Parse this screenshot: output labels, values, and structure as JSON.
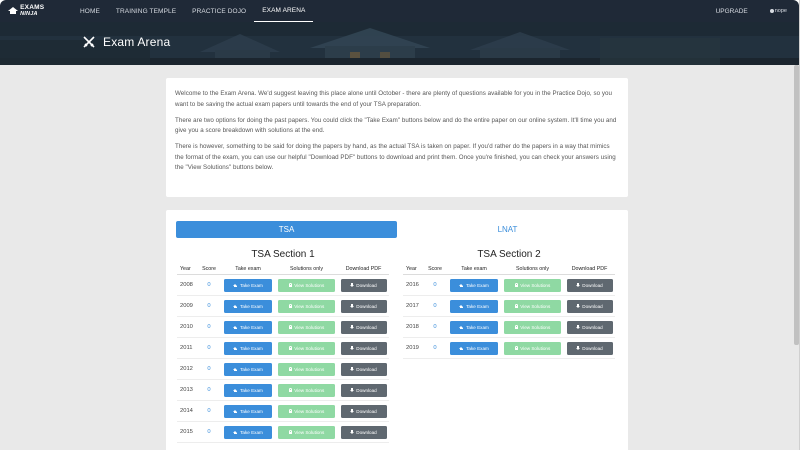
{
  "nav": {
    "logo_main": "EXAMS",
    "logo_accent": "NINJA",
    "links": [
      "HOME",
      "TRAINING TEMPLE",
      "PRACTICE DOJO",
      "EXAM ARENA"
    ],
    "upgrade": "UPGRADE",
    "user": "nope"
  },
  "banner": {
    "title": "Exam Arena"
  },
  "intro": {
    "p1": "Welcome to the Exam Arena. We'd suggest leaving this place alone until October - there are plenty of questions available for you in the Practice Dojo, so you want to be saving the actual exam papers until towards the end of your TSA preparation.",
    "p2": "There are two options for doing the past papers. You could click the \"Take Exam\" buttons below and do the entire paper on our online system. It'll time you and give you a score breakdown with solutions at the end.",
    "p3": "There is however, something to be said for doing the papers by hand, as the actual TSA is taken on paper. If you'd rather do the papers in a way that mimics the format of the exam, you can use our helpful \"Download PDF\" buttons to download and print them. Once you're finished, you can check your answers using the \"View Solutions\" buttons below."
  },
  "tabs": {
    "tsa": "TSA",
    "lnat": "LNAT"
  },
  "table": {
    "headers": {
      "year": "Year",
      "score": "Score",
      "take": "Take exam",
      "solutions": "Solutions only",
      "pdf": "Download PDF"
    },
    "buttons": {
      "take": "Take Exam",
      "solutions": "View Solutions",
      "download": "Download"
    }
  },
  "section1": {
    "title": "TSA Section 1",
    "rows": [
      {
        "year": "2008",
        "score": "0"
      },
      {
        "year": "2009",
        "score": "0"
      },
      {
        "year": "2010",
        "score": "0"
      },
      {
        "year": "2011",
        "score": "0"
      },
      {
        "year": "2012",
        "score": "0"
      },
      {
        "year": "2013",
        "score": "0"
      },
      {
        "year": "2014",
        "score": "0"
      },
      {
        "year": "2015",
        "score": "0"
      }
    ]
  },
  "section2": {
    "title": "TSA Section 2",
    "rows": [
      {
        "year": "2016",
        "score": "0"
      },
      {
        "year": "2017",
        "score": "0"
      },
      {
        "year": "2018",
        "score": "0"
      },
      {
        "year": "2019",
        "score": "0"
      }
    ]
  },
  "colors": {
    "accent": "#3b8edb",
    "success": "#8fd9a3",
    "dark": "#5f6870",
    "navbar": "#1f2937"
  }
}
